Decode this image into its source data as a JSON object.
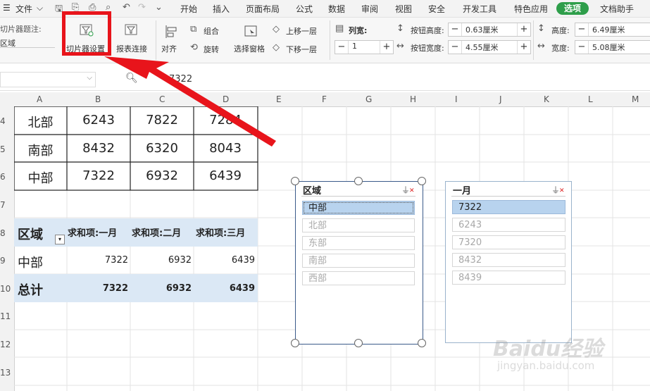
{
  "menubar": {
    "file": "文件",
    "tabs": [
      "开始",
      "插入",
      "页面布局",
      "公式",
      "数据",
      "审阅",
      "视图",
      "安全",
      "开发工具",
      "特色应用"
    ],
    "active_tab": "选项",
    "assistant": "文档助手"
  },
  "ribbon": {
    "slicer_caption_label": "切片器题注:",
    "slicer_caption_value": "区域",
    "slicer_settings": "切片器设置",
    "report_connections": "报表连接",
    "align": "对齐",
    "group": "组合",
    "rotate": "旋转",
    "selection_pane": "选择窗格",
    "bring_forward": "上移一层",
    "send_backward": "下移一层",
    "columns_label": "列宽:",
    "columns_value": "1",
    "button_height_label": "按钮高度:",
    "button_height_value": "0.63厘米",
    "button_width_label": "按钮宽度:",
    "button_width_value": "4.55厘米",
    "height_label": "高度:",
    "height_value": "6.49厘米",
    "width_label": "宽度:",
    "width_value": "5.08厘米"
  },
  "formula_bar": {
    "value": "7322"
  },
  "columns": [
    "A",
    "B",
    "C",
    "D",
    "E",
    "F",
    "G",
    "H",
    "I",
    "J",
    "K",
    "L",
    "M"
  ],
  "rows": [
    "4",
    "5",
    "6",
    "7",
    "8",
    "9",
    "10",
    "11",
    "12",
    "13"
  ],
  "table": [
    [
      "北部",
      "6243",
      "7822",
      "7284"
    ],
    [
      "南部",
      "8432",
      "6320",
      "8043"
    ],
    [
      "中部",
      "7322",
      "6932",
      "6439"
    ]
  ],
  "pivot": {
    "header_label": "区域",
    "col1": "求和项:一月",
    "col2": "求和项:二月",
    "col3": "求和项:三月",
    "row_label": "中部",
    "row_values": [
      "7322",
      "6932",
      "6439"
    ],
    "total_label": "总计",
    "total_values": [
      "7322",
      "6932",
      "6439"
    ]
  },
  "slicer_region": {
    "title": "区域",
    "items": [
      "中部",
      "北部",
      "东部",
      "南部",
      "西部"
    ],
    "selected": "中部"
  },
  "slicer_month": {
    "title": "一月",
    "items": [
      "7322",
      "6243",
      "7320",
      "8432",
      "8439"
    ],
    "selected": "7322"
  },
  "watermark": {
    "brand": "Baidu经验",
    "url": "jingyan.baidu.com"
  },
  "colors": {
    "accent_green": "#2e9e4a",
    "highlight_red": "#e8141b",
    "pivot_blue": "#dbe8f5"
  }
}
